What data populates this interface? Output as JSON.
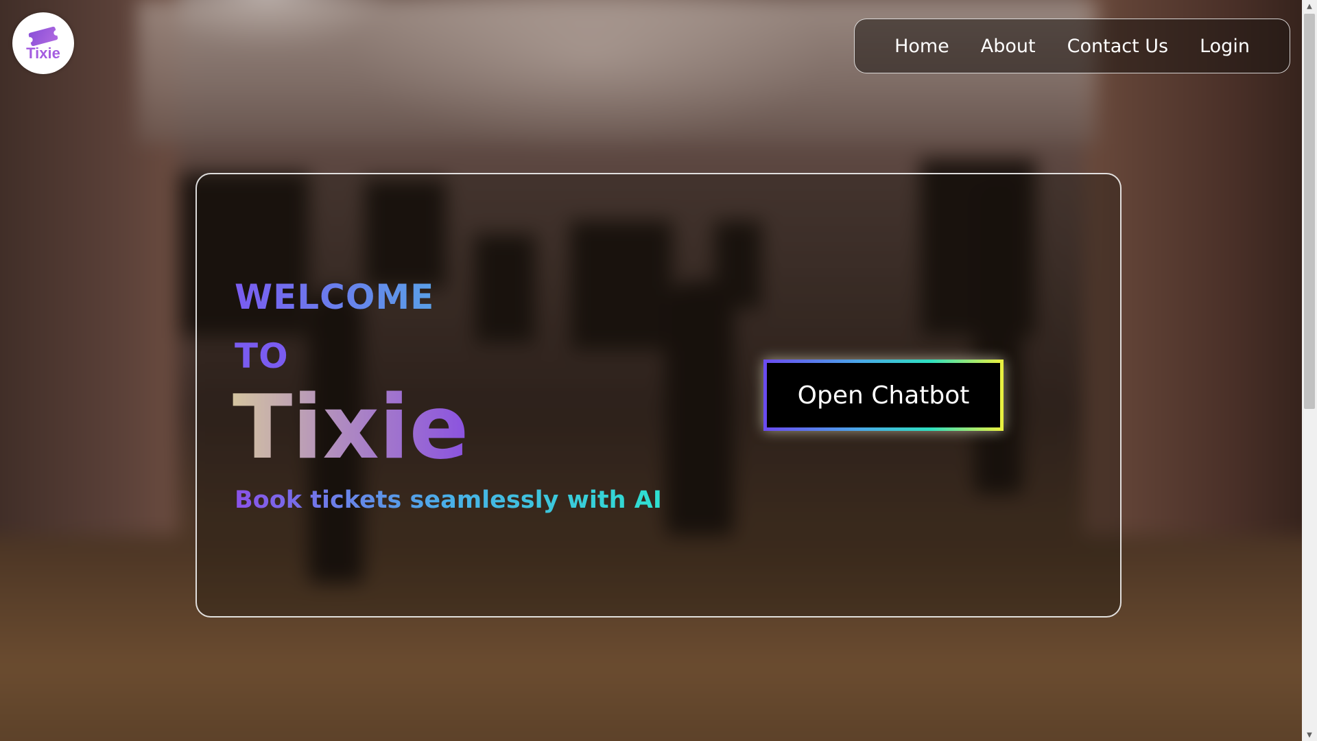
{
  "brand": {
    "logo_text": "Tixie",
    "logo_icon": "ticket-icon"
  },
  "nav": {
    "items": [
      {
        "label": "Home"
      },
      {
        "label": "About"
      },
      {
        "label": "Contact Us"
      },
      {
        "label": "Login"
      }
    ]
  },
  "hero": {
    "welcome": "WELCOME",
    "to": "TO",
    "title": "Tixie",
    "tagline": "Book tickets seamlessly with AI",
    "chatbot_button": "Open Chatbot"
  },
  "colors": {
    "accent_purple": "#7a5cf0",
    "accent_cyan": "#2ee0d0",
    "accent_yellow": "#e8f040",
    "button_bg": "#000000"
  },
  "scrollbar": {
    "up_icon": "scroll-up-arrow-icon",
    "down_icon": "scroll-down-arrow-icon"
  }
}
